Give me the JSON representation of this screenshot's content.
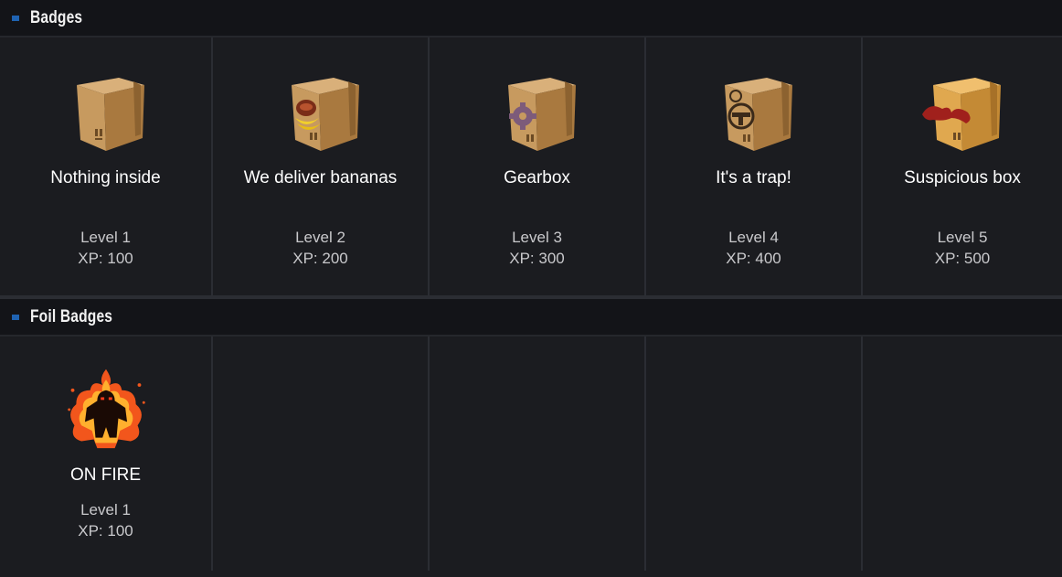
{
  "sections": {
    "badges": {
      "title": "Badges",
      "items": [
        {
          "name": "Nothing inside",
          "level": "Level 1",
          "xp": "XP: 100",
          "icon": "cardboard-box-icon"
        },
        {
          "name": "We deliver bananas",
          "level": "Level 2",
          "xp": "XP: 200",
          "icon": "banana-box-icon"
        },
        {
          "name": "Gearbox",
          "level": "Level 3",
          "xp": "XP: 300",
          "icon": "gear-box-icon"
        },
        {
          "name": "It's a trap!",
          "level": "Level 4",
          "xp": "XP: 400",
          "icon": "trap-box-icon"
        },
        {
          "name": "Suspicious box",
          "level": "Level 5",
          "xp": "XP: 500",
          "icon": "mustache-box-icon"
        }
      ]
    },
    "foil": {
      "title": "Foil Badges",
      "items": [
        {
          "name": "ON FIRE",
          "level": "Level 1",
          "xp": "XP: 100",
          "icon": "fire-figure-icon"
        }
      ]
    }
  },
  "colors": {
    "accent": "#1f63b2",
    "background": "#1b1c20",
    "header": "#131418"
  }
}
